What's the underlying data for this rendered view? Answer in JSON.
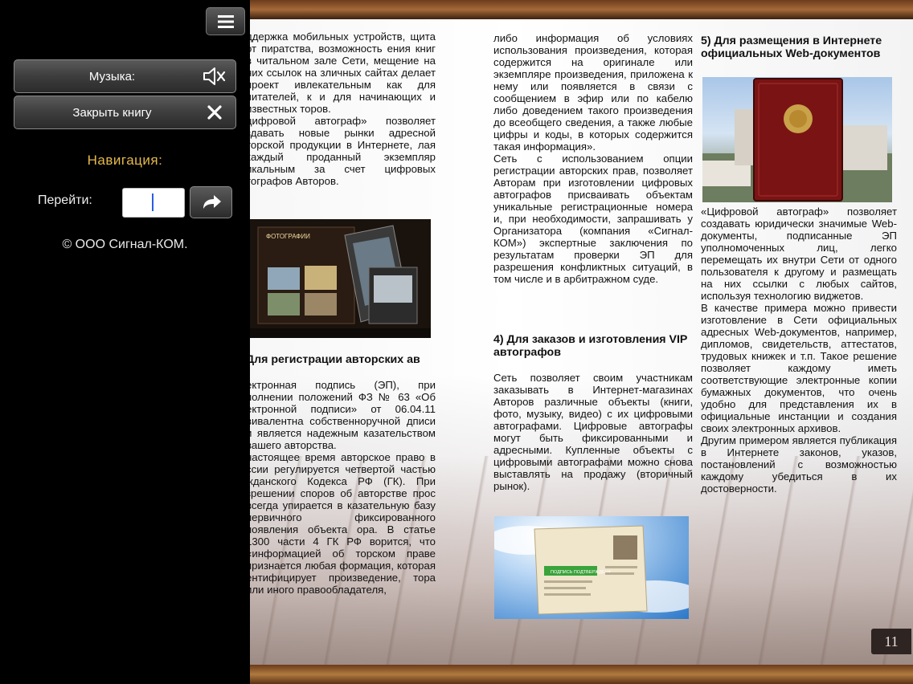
{
  "panel": {
    "music_label": "Музыка:",
    "close_label": "Закрыть книгу",
    "nav_title": "Навигация:",
    "goto_label": "Перейти:",
    "goto_value": "",
    "copyright": "© ООО Сигнал-КОМ.",
    "accent": "#e6b94b"
  },
  "page": {
    "number": "11",
    "col1": {
      "text_top": "ддержка мобильных устройств, щита от пиратства, возможность ения книг в читальном зале Сети, мещение на них ссылок на зличных сайтах делает проект ивлекательным как для читателей, к и для начинающих и известных торов.\nцифровой автограф» позволяет здавать новые рынки адресной торской продукции в Интернете, лая каждый проданный экземпляр икальным за счет цифровых тографов Авторов.",
      "heading": "Для регистрации авторских ав",
      "text_bottom": "ектронная подпись (ЭП), при полнении положений ФЗ № 63 «Об ектронной подписи» от 06.04.11 вивалентна собственноручной дписи и является надежным казательством вашего авторства.\nнастоящее время авторское право в ссии регулируется четвертой частью жданского Кодекса РФ (ГК). При зрешении споров об авторстве прос всегда упирается в казательную базу первичного фиксированного появления объекта ора. В статье 1300 части 4 ГК РФ ворится, что «информацией об торском праве признается любая формация, которая ентифицирует произведение, тора или иного правообладателя,"
    },
    "col2": {
      "text_top": "либо информация об условиях использования произведения, которая содержится на оригинале или экземпляре произведения, приложена к нему или появляется в связи с сообщением в эфир или по кабелю либо доведением такого произведения до всеобщего сведения, а также любые цифры и коды, в которых содержится такая информация».",
      "text_mid": "Сеть с использованием опции регистрации авторских прав, позволяет Авторам при изготовлении цифровых автографов присваивать объектам уникальные регистрационные номера и, при необходимости, запрашивать у Организатора (компания «Сигнал-КОМ») экспертные заключения по результатам проверки ЭП для разрешения конфликтных ситуаций, в том числе и в арбитражном суде.",
      "heading": "4) Для заказов и изготовления VIP автографов",
      "text_bottom": "Сеть позволяет своим участникам заказывать в Интернет-магазинах Авторов различные объекты (книги, фото, музыку, видео) с их цифровыми автографами. Цифровые автографы могут быть фиксированными и адресными. Купленные объекты с цифровыми автографами можно снова выставлять на продажу (вторичный рынок)."
    },
    "col3": {
      "heading": "5) Для размещения в Интернете официальных Web-документов",
      "p1": "«Цифровой автограф» позволяет создавать юридически значимые Web-документы, подписанные ЭП уполномоченных лиц, легко перемещать их внутри Сети от одного пользователя к другому и размещать на них ссылки с любых сайтов, используя технологию виджетов.",
      "p2": "В качестве примера можно привести изготовление в Сети официальных адресных Web-документов, например, дипломов, свидетельств, аттестатов, трудовых книжек и т.п. Такое решение позволяет каждому иметь соответствующие электронные копии бумажных документов, что очень удобно для представления их в официальные инстанции и создания своих электронных архивов.",
      "p3": "Другим примером является публикация в Интернете законов, указов, постановлений с возможностью каждому убедиться в их достоверности."
    },
    "img1_caption": "ФОТОГРАФИИ",
    "img3_badge": "ПОДПИСЬ ПОДТВЕРЖДЕНА"
  }
}
